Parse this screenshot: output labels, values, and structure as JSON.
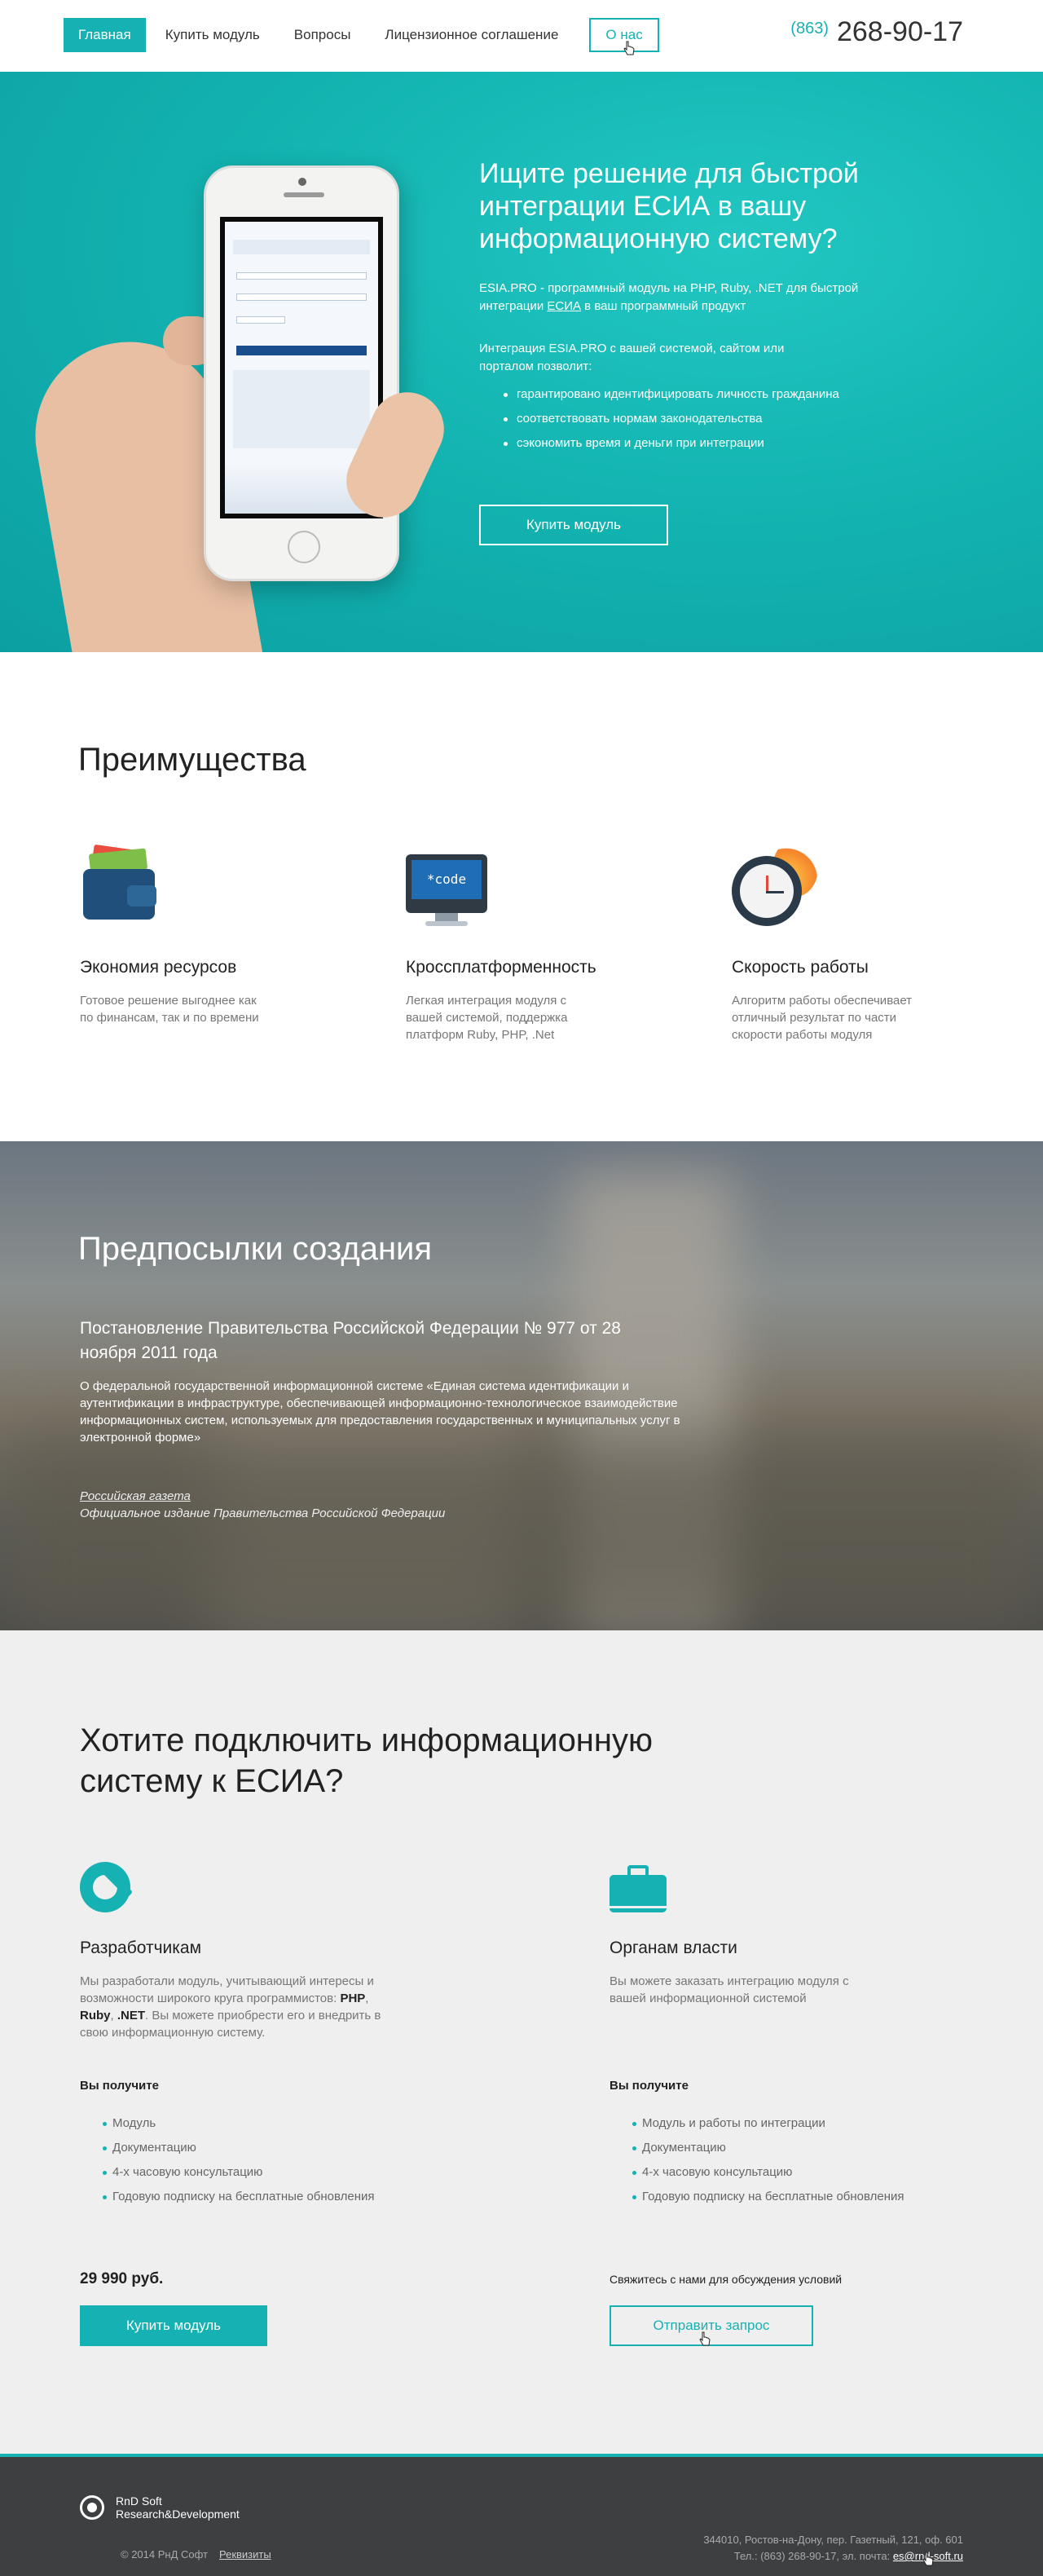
{
  "header": {
    "nav": {
      "home": "Главная",
      "buy": "Купить модуль",
      "faq": "Вопросы",
      "license": "Лицензионное соглашение",
      "about": "О нас"
    },
    "phone_code": "(863)",
    "phone_number": "268-90-17"
  },
  "hero": {
    "title": "Ищите решение для быстрой интеграции ЕСИА в вашу информационную систему?",
    "desc_before": "ESIA.PRO - программный модуль на PHP, Ruby, .NET для быстрой интеграции ",
    "desc_link": "ЕСИА",
    "desc_after": " в ваш программный продукт",
    "intro": "Интеграция ESIA.PRO с вашей системой, сайтом или порталом позволит:",
    "benefits": [
      "гарантировано идентифицировать личность гражданина",
      "соответствовать нормам законодательства",
      "сэкономить время и деньги при интеграции"
    ],
    "button": "Купить модуль"
  },
  "advantages": {
    "title": "Преимущества",
    "items": [
      {
        "icon": "wallet-icon",
        "title": "Экономия ресурсов",
        "text": "Готовое решение выгоднее как по финансам, так и по времени"
      },
      {
        "icon": "monitor-code-icon",
        "title": "Кроссплатформенность",
        "text": "Легкая интеграция модуля с вашей системой, поддержка платформ Ruby, PHP, .Net"
      },
      {
        "icon": "clock-icon",
        "title": "Скорость работы",
        "text": "Алгоритм работы обеспечивает отличный результат по части скорости работы модуля"
      }
    ],
    "monitor_label": "*code"
  },
  "history": {
    "title": "Предпосылки создания",
    "subtitle": "Постановление Правительства Российской Федерации № 977 от 28 ноября 2011 года",
    "text": "О федеральной государственной информационной системе «Единая система идентификации и аутентификации в инфраструктуре, обеспечивающей информационно-технологическое взаимодействие информационных систем, используемых для предоставления государственных и муниципальных услуг в электронной форме»",
    "source_link": "Российская газета",
    "source_note": "Официальное издание Правительства Российской Федерации"
  },
  "connect": {
    "title": "Хотите подключить информационную систему к ЕСИА?",
    "developers": {
      "title": "Разработчикам",
      "desc_1": "Мы разработали модуль, учитывающий интересы и возможности широкого круга программистов: ",
      "lang_php": "PHP",
      "sep1": ", ",
      "lang_ruby": "Ruby",
      "sep2": ", ",
      "lang_net": ".NET",
      "desc_2": ". Вы можете приобрести его и внедрить в свою информационную систему.",
      "get_title": "Вы получите",
      "items": [
        "Модуль",
        "Документацию",
        "4-х часовую консультацию",
        "Годовую подписку на бесплатные обновления"
      ],
      "price": "29 990 руб.",
      "button": "Купить модуль"
    },
    "government": {
      "title": "Органам власти",
      "desc": "Вы можете заказать интеграцию модуля с вашей информационной системой",
      "get_title": "Вы получите",
      "items": [
        "Модуль и работы по интеграции",
        "Документацию",
        "4-х часовую консультацию",
        "Годовую подписку на бесплатные обновления"
      ],
      "note": "Свяжитесь с нами для обсуждения условий",
      "button": "Отправить запрос"
    }
  },
  "footer": {
    "logo_line1": "RnD Soft",
    "logo_line2": "Research&Development",
    "copyright": "© 2014 РнД Софт",
    "requisites": "Реквизиты",
    "address": "344010, Ростов-на-Дону, пер. Газетный, 121, оф. 601",
    "contacts_prefix": "Тел.: (863) 268-90-17, эл. почта: ",
    "email": "es@rnd-soft.ru"
  },
  "colors": {
    "accent": "#16b1b3",
    "footer_bg": "#3d3f41",
    "section_gray": "#efefef"
  }
}
